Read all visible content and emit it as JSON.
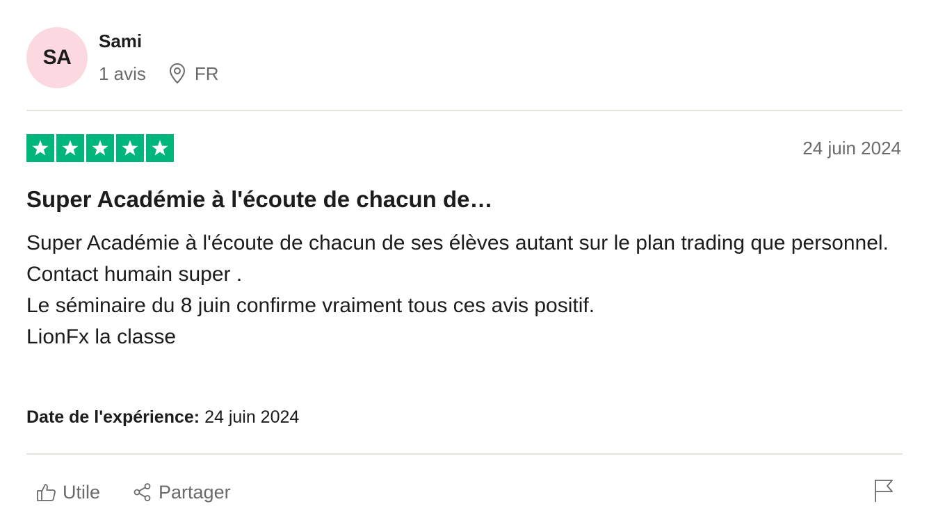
{
  "reviewer": {
    "initials": "SA",
    "name": "Sami",
    "review_count": "1 avis",
    "country": "FR",
    "avatar_color": "#fcd9e1",
    "location_icon": "location-pin-icon"
  },
  "review": {
    "rating": 5,
    "rating_max": 5,
    "star_color": "#00b67a",
    "date": "24 juin 2024",
    "title": "Super Académie à l'écoute de chacun de…",
    "body_lines": [
      "Super Académie à l'écoute de chacun de ses élèves autant sur le plan trading que personnel.",
      "Contact humain super .",
      "Le séminaire du 8 juin confirme vraiment tous ces avis positif.",
      "LionFx la classe"
    ],
    "experience_label": "Date de l'expérience:",
    "experience_date": "24 juin 2024"
  },
  "actions": {
    "useful_label": "Utile",
    "useful_icon": "thumbs-up-icon",
    "share_label": "Partager",
    "share_icon": "share-icon",
    "report_icon": "flag-icon"
  }
}
